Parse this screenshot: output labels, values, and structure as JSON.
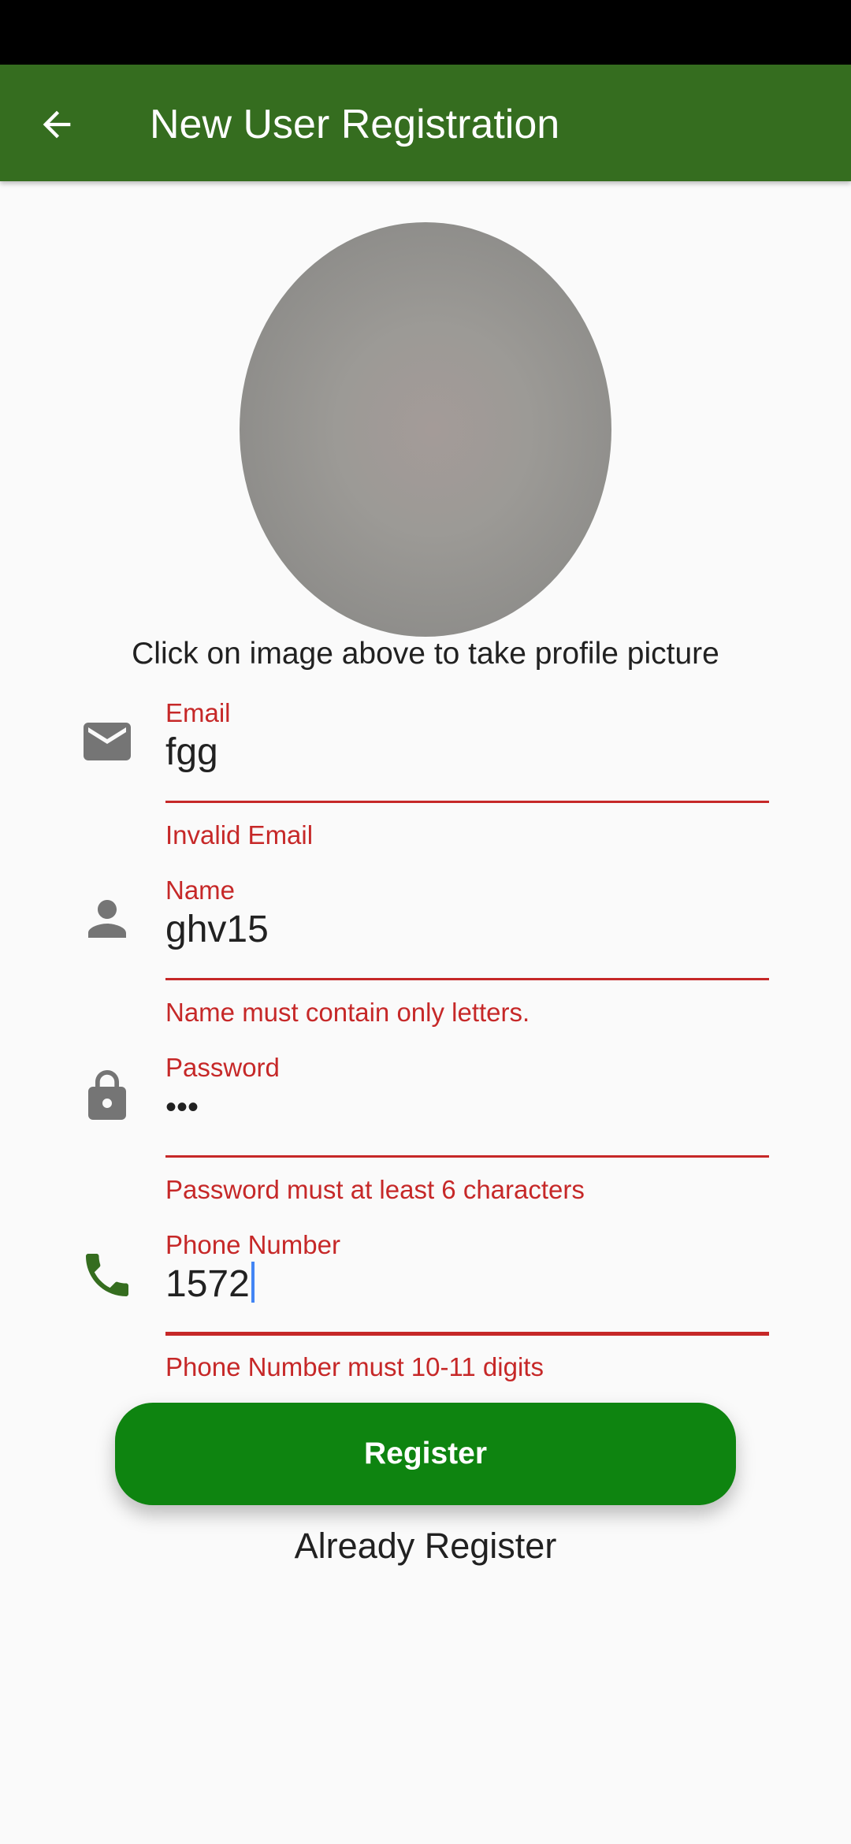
{
  "app_bar": {
    "title": "New User Registration"
  },
  "profile": {
    "hint": "Click on image above to take profile picture"
  },
  "fields": {
    "email": {
      "label": "Email",
      "value": "fgg",
      "error": "Invalid Email"
    },
    "name": {
      "label": "Name",
      "value": "ghv15",
      "error": "Name must contain only letters."
    },
    "password": {
      "label": "Password",
      "value": "•••",
      "error": "Password must at least 6 characters"
    },
    "phone": {
      "label": "Phone Number",
      "value": "1572",
      "error": "Phone Number must 10-11 digits"
    }
  },
  "actions": {
    "register_label": "Register",
    "login_link": "Already Register"
  },
  "icons": {
    "back": "arrow-back-icon",
    "email": "envelope-icon",
    "name": "person-icon",
    "password": "lock-icon",
    "phone": "phone-icon"
  },
  "colors": {
    "app_bar": "#356d1f",
    "error": "#c62828",
    "button": "#0e8410",
    "phone_icon": "#356d1f",
    "cursor": "#4285f4"
  }
}
